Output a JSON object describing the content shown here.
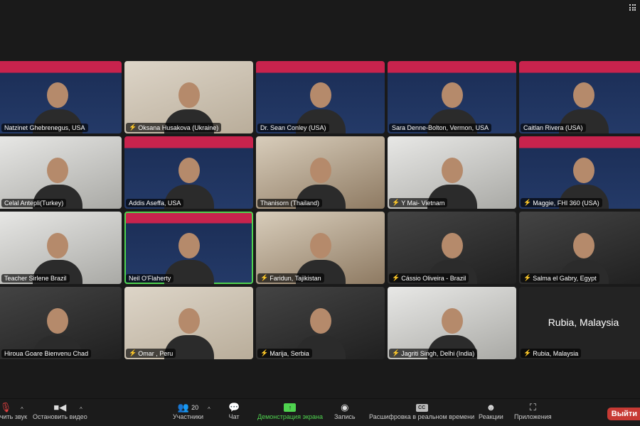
{
  "participants": [
    {
      "name": "Natzinet Ghebrenegus, USA",
      "muted": false
    },
    {
      "name": "Oksana Husakova (Ukraine)",
      "muted": true
    },
    {
      "name": "Dr. Sean Conley (USA)",
      "muted": false
    },
    {
      "name": "Sara Denne-Bolton, Vermon, USA",
      "muted": false
    },
    {
      "name": "Caitlan Rivera (USA)",
      "muted": false
    },
    {
      "name": "Celal Antepli(Turkey)",
      "muted": false
    },
    {
      "name": "Addis Aseffa, USA",
      "muted": false
    },
    {
      "name": "Thanisorn (Thailand)",
      "muted": false
    },
    {
      "name": "Y Mai- Vietnam",
      "muted": true
    },
    {
      "name": "Maggie, FHI 360 (USA)",
      "muted": true
    },
    {
      "name": "Teacher Sirlene Brazil",
      "muted": false
    },
    {
      "name": "Neil O'Flaherty",
      "muted": false
    },
    {
      "name": "Faridun, Tajikistan",
      "muted": true
    },
    {
      "name": "Cássio Oliveira - Brazil",
      "muted": true
    },
    {
      "name": "Salma el Gabry, Egypt",
      "muted": true
    },
    {
      "name": "Hiroua  Goare Bienvenu Chad",
      "muted": false
    },
    {
      "name": "Omar , Peru",
      "muted": true
    },
    {
      "name": "Marija, Serbia",
      "muted": true
    },
    {
      "name": "Jagriti Singh, Delhi (India)",
      "muted": true
    },
    {
      "name": "Rubia, Malaysia",
      "muted": true,
      "video_off": true
    }
  ],
  "toolbar": {
    "unmute": "Включить звук",
    "stop_video": "Остановить видео",
    "participants": "Участники",
    "participants_count": "20",
    "chat": "Чат",
    "share_screen": "Демонстрация экрана",
    "record": "Запись",
    "transcription": "Расшифровка в реальном времени",
    "cc": "CC",
    "reactions": "Реакции",
    "apps": "Приложения",
    "leave": "Выйти"
  }
}
